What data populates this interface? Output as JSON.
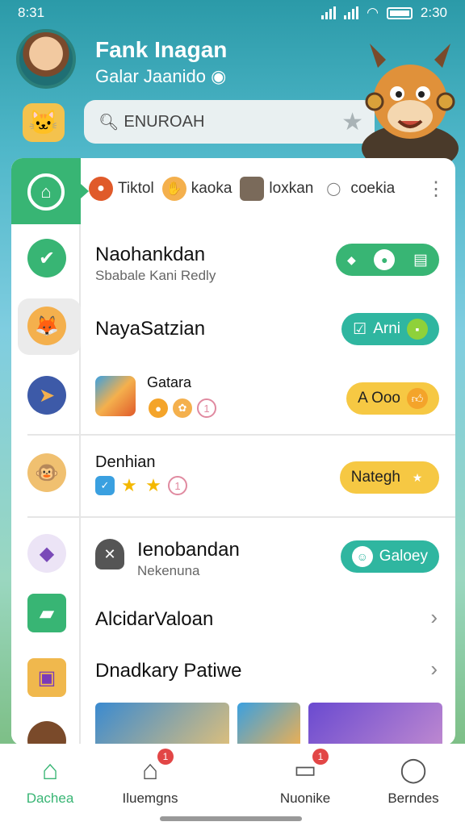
{
  "status": {
    "time": "8:31",
    "battery_text": "2:30"
  },
  "profile": {
    "name": "Fank Inagan",
    "subtitle": "Galar Jaanido"
  },
  "search": {
    "placeholder": "ENUROAH"
  },
  "topbar": {
    "items": [
      {
        "label": "Tiktol"
      },
      {
        "label": "kaoka"
      },
      {
        "label": "loxkan"
      },
      {
        "label": "coekia"
      }
    ]
  },
  "rows": [
    {
      "title": "Naohankdan",
      "subtitle": "Sbabale Kani Redly",
      "action": ""
    },
    {
      "title": "NayaSatzian",
      "subtitle": "",
      "action": "Arni"
    },
    {
      "title": "Gatara",
      "subtitle": "",
      "action": "A Ooo"
    },
    {
      "title": "Denhian",
      "subtitle": "",
      "action": "Nategh"
    },
    {
      "title": "Ienobandan",
      "subtitle": "Nekenuna",
      "action": "Galoey"
    },
    {
      "title": "AlcidarValoan",
      "subtitle": "",
      "action": ""
    },
    {
      "title": "Dnadkary Patiwe",
      "subtitle": "",
      "action": ""
    }
  ],
  "bottom_nav": [
    {
      "label": "Dachea",
      "badge": ""
    },
    {
      "label": "Iluemgns",
      "badge": "1"
    },
    {
      "label": "Nuonike",
      "badge": "1"
    },
    {
      "label": "Berndes",
      "badge": ""
    }
  ],
  "colors": {
    "accent_green": "#38b574",
    "teal": "#2fb6a0",
    "yellow": "#f6c843"
  }
}
